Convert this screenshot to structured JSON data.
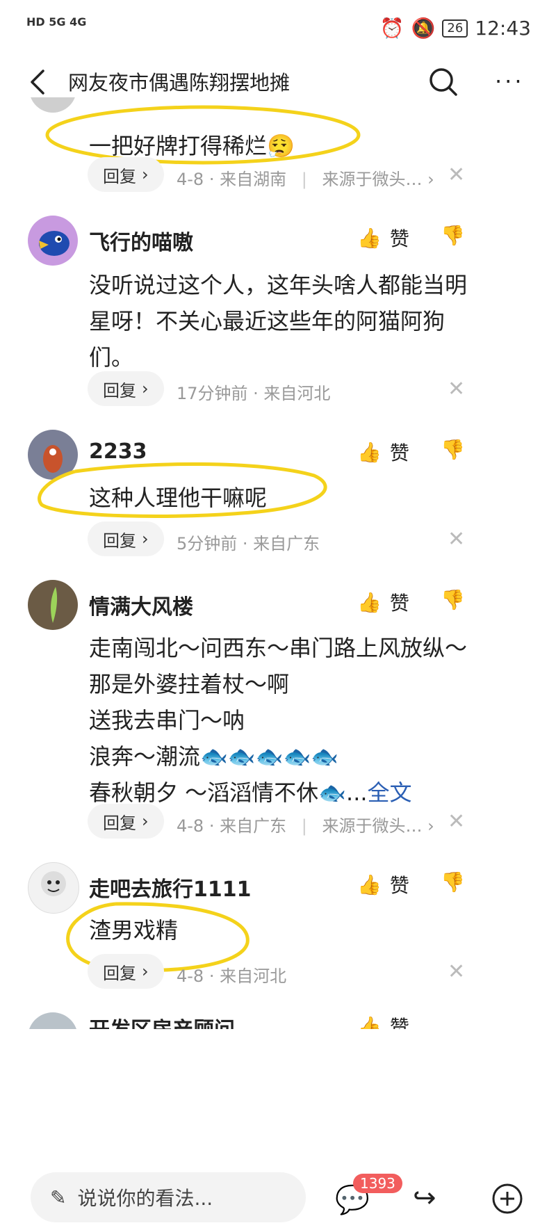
{
  "status_bar": {
    "left_indicators": "HD 5G 4G",
    "battery": "26",
    "time": "12:43"
  },
  "header": {
    "title": "网友夜市偶遇陈翔摆地摊",
    "more": "···"
  },
  "comments": [
    {
      "text": "一把好牌打得稀烂",
      "emoji": "😮‍💨",
      "reply": "回复",
      "meta": "4-8 · 来自湖南",
      "source": "来源于微头…"
    },
    {
      "user": "飞行的喵嗷",
      "like": "赞",
      "text_lines": [
        "没听说过这个人，这年头啥人都能当明",
        "星呀！不关心最近这些年的阿猫阿狗",
        "们。"
      ],
      "reply": "回复",
      "meta": "17分钟前 · 来自河北"
    },
    {
      "user": "2233",
      "like": "赞",
      "text": "这种人理他干嘛呢",
      "reply": "回复",
      "meta": "5分钟前 · 来自广东"
    },
    {
      "user": "情满大风楼",
      "like": "赞",
      "text_lines": [
        "走南闯北～问西东～串门路上风放纵～",
        "那是外婆拄着杖～啊",
        "送我去串门～呐",
        "浪奔～潮流",
        "春秋朝夕 ～滔滔情不休"
      ],
      "ellipsis": "...",
      "full_text": "全文",
      "reply": "回复",
      "meta": "4-8 · 来自广东",
      "source": "来源于微头…"
    },
    {
      "user": "走吧去旅行1111",
      "like": "赞",
      "text": "渣男戏精",
      "reply": "回复",
      "meta": "4-8 · 来自河北"
    },
    {
      "user": "开发区房产顾问",
      "like": "赞"
    }
  ],
  "bottom_bar": {
    "placeholder": "说说你的看法...",
    "comment_count": "1393"
  },
  "colors": {
    "highlight_circle": "#f4d21b",
    "badge": "#f25d5d",
    "link": "#2b5fb4"
  }
}
